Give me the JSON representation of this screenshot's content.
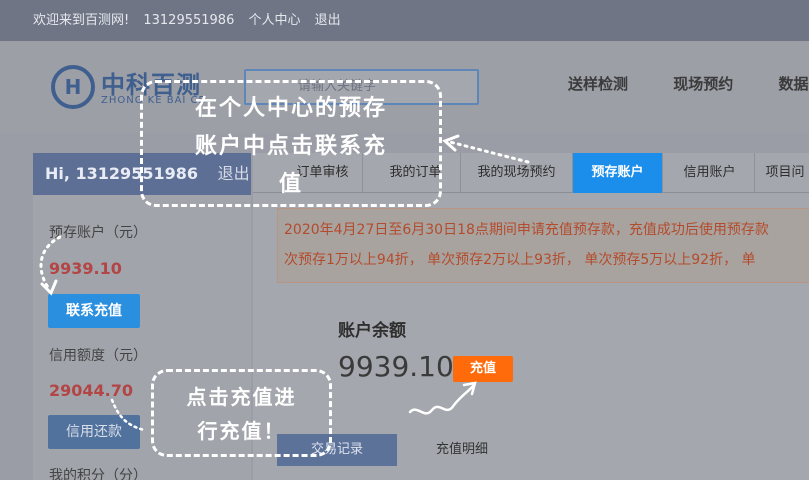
{
  "topbar": {
    "welcome": "欢迎来到百测网!",
    "phone": "13129551986",
    "profile": "个人中心",
    "logout": "退出"
  },
  "header": {
    "logo_mark": "H",
    "logo_text": "中科百测",
    "logo_sub": "ZHONG KE BAI CE",
    "search_placeholder": "请输入关键字",
    "nav": [
      "送样检测",
      "现场预约",
      "数据"
    ]
  },
  "sidebar": {
    "greeting": "Hi, 13129551986",
    "logout": "退出",
    "deposit_label": "预存账户（元）",
    "deposit_value": "9939.10",
    "recharge_button": "联系充值",
    "credit_label": "信用额度（元）",
    "credit_value": "29044.70",
    "repay_button": "信用还款",
    "points_label": "我的积分（分）"
  },
  "tabs": [
    "订单审核",
    "我的订单",
    "我的现场预约",
    "预存账户",
    "信用账户",
    "项目问"
  ],
  "active_tab": "预存账户",
  "notice": {
    "line1": "2020年4月27日至6月30日18点期间申请充值预存款，充值成功后使用预存款",
    "line2": "次预存1万以上94折，  单次预存2万以上93折，  单次预存5万以上92折，  单"
  },
  "balance": {
    "label": "账户余额",
    "value": "9939.10",
    "charge_button": "充值"
  },
  "subtabs": [
    "交易记录",
    "充值明细"
  ],
  "annotations": {
    "callout1_line1": "在个人中心的预存",
    "callout1_line2": "账户中点击联系充",
    "callout1_line3": "值",
    "callout2_line1": "点击充值进",
    "callout2_line2": "行充值！"
  },
  "colors": {
    "active_tab": "#1a8eea",
    "charge_button": "#ff6a0a",
    "recharge_button": "#2b8fdf",
    "notice_text": "#b44b2c"
  }
}
